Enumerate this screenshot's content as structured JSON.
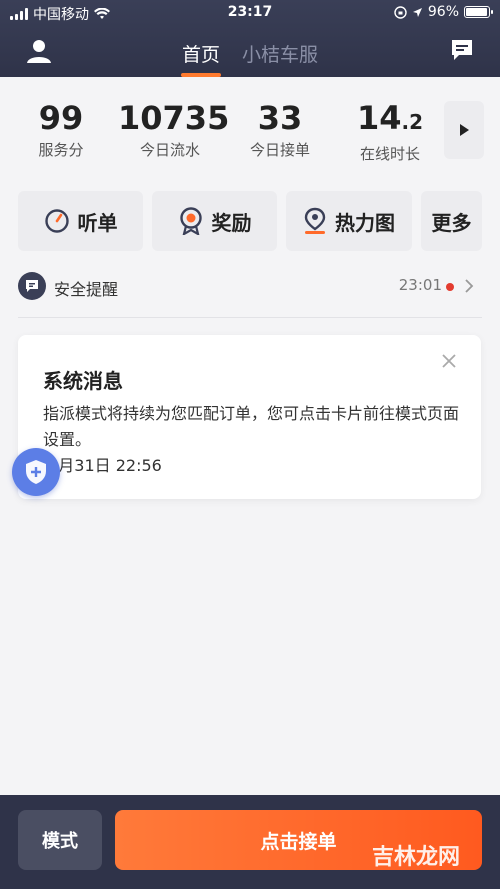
{
  "status_bar": {
    "carrier": "中国移动",
    "time": "23:17",
    "battery": "96%",
    "battery_level": 0.96,
    "icons": [
      "signal-icon",
      "wifi-icon",
      "orientation-lock-icon",
      "location-icon",
      "battery-icon"
    ]
  },
  "nav": {
    "tabs": [
      {
        "label": "首页",
        "active": true
      },
      {
        "label": "小桔车服",
        "active": false
      }
    ],
    "user_icon": "user-icon",
    "message_icon": "message-icon"
  },
  "stats": [
    {
      "value": "99",
      "label": "服务分"
    },
    {
      "value": "10735",
      "label": "今日流水"
    },
    {
      "value": "33",
      "label": "今日接单"
    },
    {
      "value": "14",
      "value_decimal": ".2",
      "label": "在线时长"
    }
  ],
  "quick_actions": [
    {
      "label": "听单",
      "icon": "timer-icon"
    },
    {
      "label": "奖励",
      "icon": "medal-icon"
    },
    {
      "label": "热力图",
      "icon": "location-pin-icon"
    },
    {
      "label": "更多",
      "icon": ""
    }
  ],
  "safety": {
    "label": "安全提醒",
    "time": "23:01",
    "dot_color": "#e33b2f"
  },
  "message_card": {
    "title": "系统消息",
    "body": "指派模式将持续为您匹配订单，您可点击卡片前往模式页面设置。",
    "time": "月31日 22:56"
  },
  "bottom": {
    "mode_label": "模式",
    "take_order_label": "点击接单",
    "watermark": "吉林龙网"
  },
  "colors": {
    "header_bg": "#2f3349",
    "accent_orange": "#ff6a2a",
    "shield_blue": "#5c7ee6"
  }
}
